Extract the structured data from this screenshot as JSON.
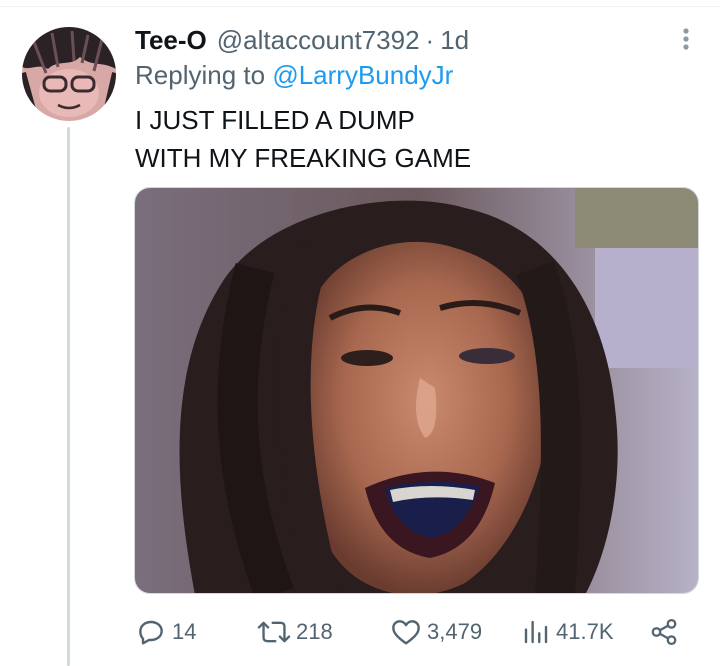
{
  "tweet": {
    "author": {
      "display_name": "Tee-O",
      "handle": "@altaccount7392",
      "avatar_icon": "avatar-image"
    },
    "separator": "·",
    "timestamp": "1d",
    "reply_prefix": "Replying to",
    "reply_to": "@LarryBundyJr",
    "text": "I JUST FILLED A DUMP\nWITH MY FREAKING GAME",
    "media": {
      "description_icon": "media-image"
    },
    "actions": {
      "reply": {
        "icon": "reply-icon",
        "count": "14"
      },
      "retweet": {
        "icon": "retweet-icon",
        "count": "218"
      },
      "like": {
        "icon": "like-icon",
        "count": "3,479"
      },
      "views": {
        "icon": "views-icon",
        "count": "41.7K"
      },
      "share": {
        "icon": "share-icon"
      }
    },
    "more_icon": "more-icon"
  },
  "colors": {
    "text_primary": "#0f1419",
    "text_secondary": "#536471",
    "link": "#1d9bf0",
    "thread_line": "#cfd9de"
  }
}
